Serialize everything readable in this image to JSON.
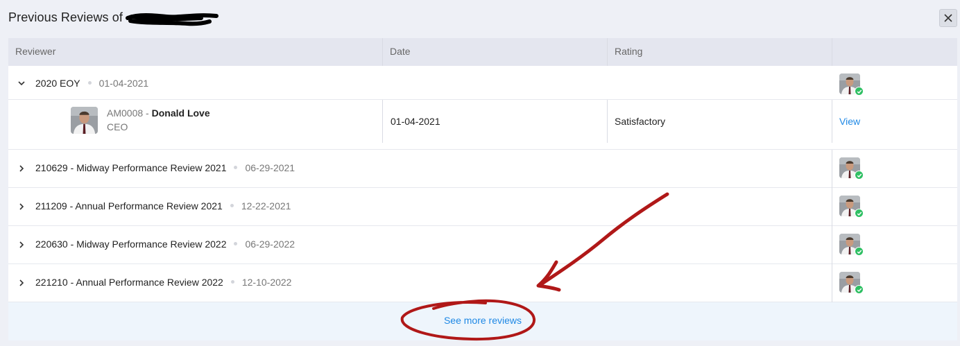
{
  "header": {
    "title": "Previous Reviews of"
  },
  "columns": [
    "Reviewer",
    "Date",
    "Rating",
    ""
  ],
  "reviews": [
    {
      "title": "2020 EOY",
      "date": "01-04-2021",
      "expanded": true
    },
    {
      "title": "210629 - Midway Performance Review 2021",
      "date": "06-29-2021",
      "expanded": false
    },
    {
      "title": "211209 - Annual Performance Review 2021",
      "date": "12-22-2021",
      "expanded": false
    },
    {
      "title": "220630 - Midway Performance Review 2022",
      "date": "06-29-2022",
      "expanded": false
    },
    {
      "title": "221210 - Annual Performance Review 2022",
      "date": "12-10-2022",
      "expanded": false
    }
  ],
  "detail": {
    "employee_id": "AM0008",
    "separator": " - ",
    "name": "Donald Love",
    "role": "CEO",
    "date": "01-04-2021",
    "rating": "Satisfactory",
    "action": "View"
  },
  "footer": {
    "see_more": "See more reviews"
  },
  "icons": {
    "close": "close-icon",
    "expanded": "chevron-down-icon",
    "collapsed": "chevron-right-icon",
    "status": "check-icon"
  },
  "colors": {
    "link": "#1e88e5",
    "status": "#2fbf63",
    "annotation": "#b01818"
  }
}
